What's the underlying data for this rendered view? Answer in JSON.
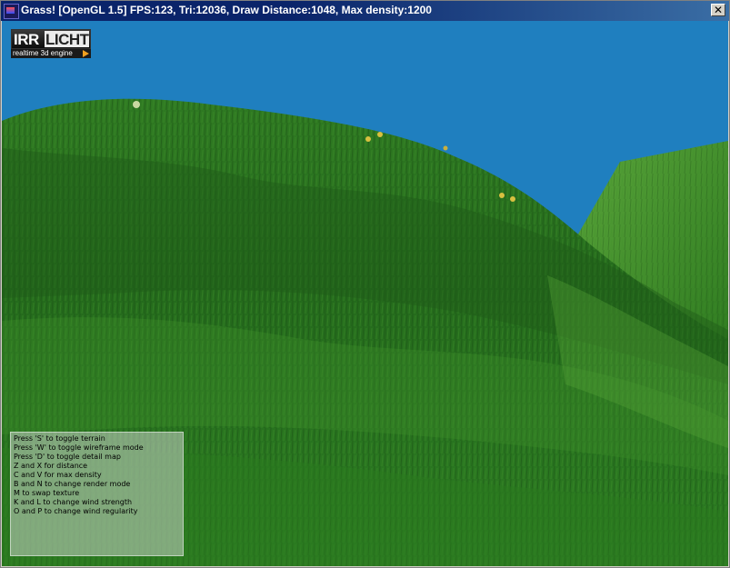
{
  "window": {
    "title": "Grass! [OpenGL 1.5] FPS:123, Tri:12036, Draw Distance:1048, Max density:1200",
    "close_glyph": "✕"
  },
  "logo": {
    "irr": "IRR",
    "licht": "LICHT",
    "tagline": "realtime 3d engine"
  },
  "help": {
    "lines": [
      "Press 'S' to toggle terrain",
      "Press 'W' to toggle wireframe mode",
      "Press 'D' to toggle detail map",
      "Z and X for distance",
      "C and V for max density",
      "B and N to change render mode",
      "M to swap texture",
      "K and L to change wind strength",
      "O and P to change wind regularity"
    ]
  },
  "colors": {
    "sky": "#1f7fbf",
    "grass_dark": "#1f5a18",
    "grass_mid": "#2e7a20",
    "grass_light": "#4a9c2c",
    "title_bar": "#0a246a"
  },
  "icons": {
    "app": "app-icon",
    "close": "close-icon"
  }
}
